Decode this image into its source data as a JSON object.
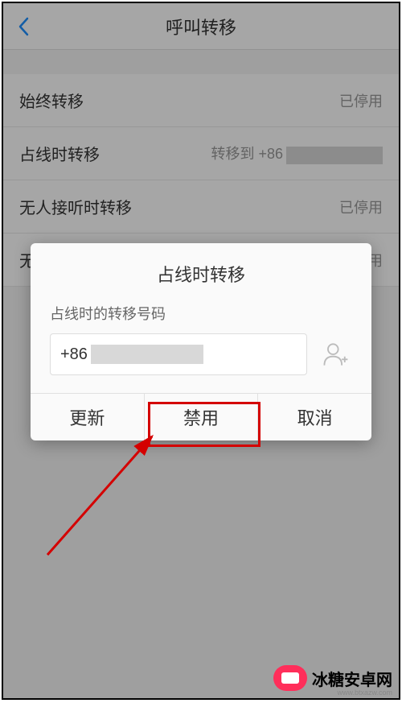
{
  "header": {
    "title": "呼叫转移"
  },
  "rows": [
    {
      "label": "始终转移",
      "status": "已停用"
    },
    {
      "label": "占线时转移",
      "status_prefix": "转移到 +86"
    },
    {
      "label": "无人接听时转移",
      "status": "已停用"
    },
    {
      "label": "无",
      "status_suffix": "用"
    }
  ],
  "dialog": {
    "title": "占线时转移",
    "field_label": "占线时的转移号码",
    "phone_prefix": "+86",
    "buttons": {
      "update": "更新",
      "disable": "禁用",
      "cancel": "取消"
    }
  },
  "watermark": {
    "text": "冰糖安卓网",
    "url": "www.btxazw.com"
  }
}
